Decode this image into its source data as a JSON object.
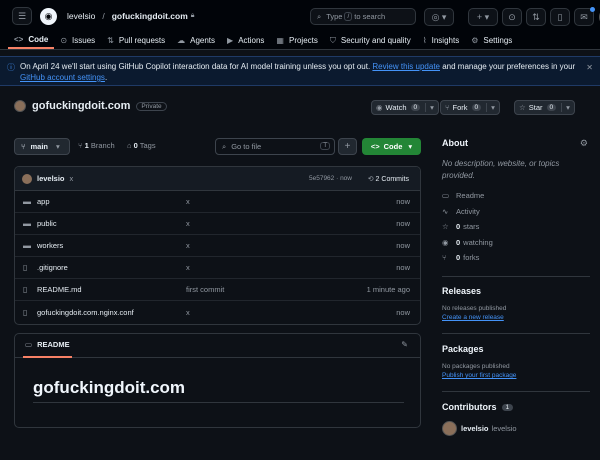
{
  "topbar": {
    "owner": "levelsio",
    "separator": "/",
    "repo": "gofuckingdoit.com",
    "search_prefix": "Type",
    "search_key": "/",
    "search_suffix": "to search"
  },
  "tabs": [
    {
      "label": "Code",
      "icon": "code-icon"
    },
    {
      "label": "Issues",
      "icon": "issue-icon"
    },
    {
      "label": "Pull requests",
      "icon": "pull-request-icon"
    },
    {
      "label": "Agents",
      "icon": "agents-icon"
    },
    {
      "label": "Actions",
      "icon": "actions-icon"
    },
    {
      "label": "Projects",
      "icon": "projects-icon"
    },
    {
      "label": "Security and quality",
      "icon": "shield-icon"
    },
    {
      "label": "Insights",
      "icon": "graph-icon"
    },
    {
      "label": "Settings",
      "icon": "gear-icon"
    }
  ],
  "banner": {
    "text_before": "On April 24 we'll start using GitHub Copilot interaction data for AI model training unless you opt out.",
    "link1": "Review this update",
    "text_middle": "and manage your preferences in your",
    "link2": "GitHub account settings",
    "text_after": "."
  },
  "repo": {
    "name": "gofuckingdoit.com",
    "visibility": "Private",
    "watch_label": "Watch",
    "watch_count": "0",
    "fork_label": "Fork",
    "fork_count": "0",
    "star_label": "Star",
    "star_count": "0"
  },
  "branchbar": {
    "branch": "main",
    "branches_count": "1",
    "branches_label": "Branch",
    "tags_count": "0",
    "tags_label": "Tags",
    "goto_placeholder": "Go to file",
    "goto_key": "T",
    "code_label": "Code"
  },
  "commit": {
    "author": "levelsio",
    "message": "x",
    "hash": "5e57962 · now",
    "commits_label": "2 Commits"
  },
  "files": [
    {
      "name": "app",
      "type": "folder",
      "message": "x",
      "time": "now"
    },
    {
      "name": "public",
      "type": "folder",
      "message": "x",
      "time": "now"
    },
    {
      "name": "workers",
      "type": "folder",
      "message": "x",
      "time": "now"
    },
    {
      "name": ".gitignore",
      "type": "file",
      "message": "x",
      "time": "now"
    },
    {
      "name": "README.md",
      "type": "file",
      "message": "first commit",
      "time": "1 minute ago"
    },
    {
      "name": "gofuckingdoit.com.nginx.conf",
      "type": "file",
      "message": "x",
      "time": "now"
    }
  ],
  "readme": {
    "tab_label": "README",
    "heading": "gofuckingdoit.com"
  },
  "about": {
    "title": "About",
    "description": "No description, website, or topics provided.",
    "readme": "Readme",
    "activity": "Activity",
    "stars_count": "0",
    "stars_label": "stars",
    "watching_count": "0",
    "watching_label": "watching",
    "forks_count": "0",
    "forks_label": "forks"
  },
  "releases": {
    "title": "Releases",
    "empty": "No releases published",
    "link": "Create a new release"
  },
  "packages": {
    "title": "Packages",
    "empty": "No packages published",
    "link": "Publish your first package"
  },
  "contributors": {
    "title": "Contributors",
    "count": "1",
    "login": "levelsio",
    "name": "levelsio"
  },
  "colors": {
    "accent_green": "#238636",
    "link_blue": "#4493f8",
    "active_tab": "#f78166"
  }
}
